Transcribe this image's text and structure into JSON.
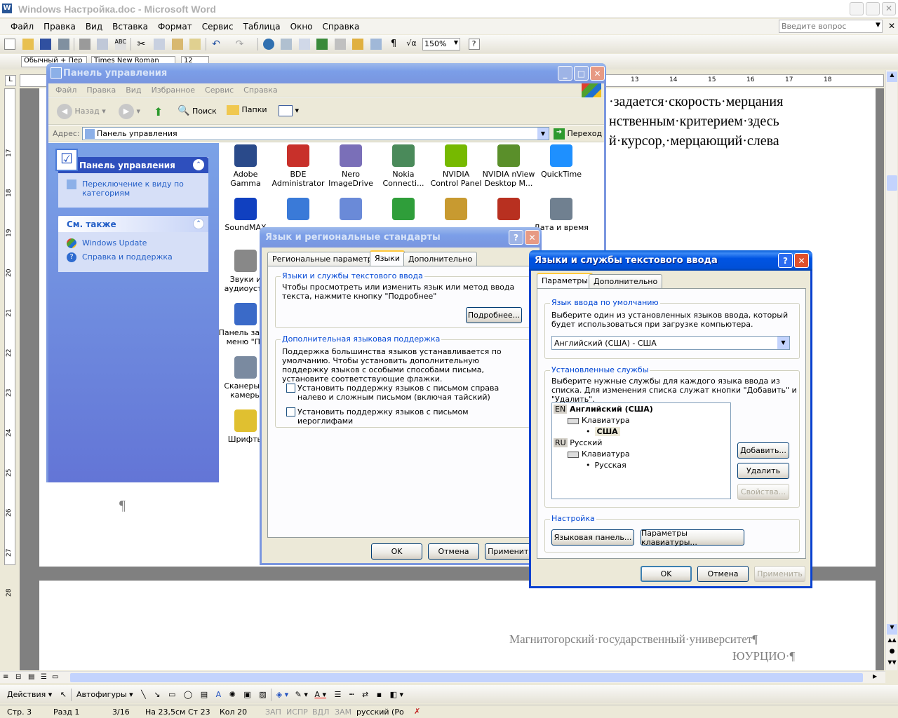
{
  "word": {
    "title": "Windows Настройка.doc - Microsoft Word",
    "menu": [
      "Файл",
      "Правка",
      "Вид",
      "Вставка",
      "Формат",
      "Сервис",
      "Таблица",
      "Окно",
      "Справка"
    ],
    "help_placeholder": "Введите вопрос",
    "zoom": "150%",
    "style_value": "Обычный + Пер",
    "font_value": "Times New Roman",
    "font_size": "12",
    "ruler_numbers": [
      "13",
      "14",
      "15",
      "16",
      "17",
      "18"
    ],
    "vruler_numbers": [
      "17",
      "18",
      "19",
      "20",
      "21",
      "22",
      "23",
      "24",
      "25",
      "26",
      "27",
      "28"
    ],
    "doc_lines": [
      "·задается·скорость·мерцания",
      "нственным·критерием·здесь",
      "й·курсор,·мерцающий·слева"
    ],
    "pilcrow": "¶",
    "footer_line1": "Магнитогорский·государственный·университет¶",
    "footer_line2": "ЮУРЦИО·¶",
    "draw_actions": "Действия",
    "draw_autoshapes": "Автофигуры",
    "status": [
      "Стр. 3",
      "Разд 1",
      "3/16",
      "На 23,5см",
      "Ст 23",
      "Кол 20",
      "ЗАП",
      "ИСПР",
      "ВДЛ",
      "ЗАМ",
      "русский (Ро"
    ]
  },
  "cp": {
    "title": "Панель управления",
    "menu": [
      "Файл",
      "Правка",
      "Вид",
      "Избранное",
      "Сервис",
      "Справка"
    ],
    "back": "Назад",
    "search": "Поиск",
    "folders": "Папки",
    "address_label": "Адрес:",
    "address_value": "Панель управления",
    "go": "Переход",
    "panel1_title": "Панель управления",
    "panel1_link": "Переключение к виду по категориям",
    "panel2_title": "См. также",
    "panel2_links": [
      "Windows Update",
      "Справка и поддержка"
    ],
    "icons": [
      {
        "label": "Adobe Gamma",
        "color": "#2a4a8a"
      },
      {
        "label": "BDE Administrator",
        "color": "#c8302a"
      },
      {
        "label": "Nero ImageDrive",
        "color": "#7a6fb8"
      },
      {
        "label": "Nokia Connecti...",
        "color": "#4a8a5a"
      },
      {
        "label": "NVIDIA Control Panel",
        "color": "#76b900"
      },
      {
        "label": "NVIDIA nView Desktop M...",
        "color": "#5a8f2a"
      },
      {
        "label": "QuickTime",
        "color": "#1e90ff"
      },
      {
        "label": "SoundMAX",
        "color": "#1040c0"
      },
      {
        "label": "",
        "color": "#3a7ad8"
      },
      {
        "label": "",
        "color": "#6a8ad8"
      },
      {
        "label": "",
        "color": "#2f9e3a"
      },
      {
        "label": "",
        "color": "#c89a30"
      },
      {
        "label": "",
        "color": "#b83020"
      },
      {
        "label": "Дата и время",
        "color": "#708090"
      },
      {
        "label": "Звуки и аудиоустр",
        "color": "#888888"
      },
      {
        "label": "Панель зад и меню \"Пу",
        "color": "#3a6ac8"
      },
      {
        "label": "Сканеры и камеры",
        "color": "#7a8aa0"
      },
      {
        "label": "Шрифты",
        "color": "#e0c030"
      }
    ]
  },
  "lang": {
    "title": "Язык и региональные стандарты",
    "tabs": [
      "Региональные параметры",
      "Языки",
      "Дополнительно"
    ],
    "group1_title": "Языки и службы текстового ввода",
    "group1_text": "Чтобы просмотреть или изменить язык или метод ввода текста, нажмите кнопку \"Подробнее\"",
    "details_btn": "Подробнее...",
    "group2_title": "Дополнительная языковая поддержка",
    "group2_text": "Поддержка большинства языков устанавливается по умолчанию. Чтобы установить дополнительную поддержку языков с особыми способами письма, установите соответствующие флажки.",
    "check1": "Установить поддержку языков с письмом справа налево и сложным письмом (включая тайский)",
    "check2": "Установить поддержку языков с письмом иероглифами",
    "ok": "OK",
    "cancel": "Отмена",
    "apply": "Применить"
  },
  "svc": {
    "title": "Языки и службы текстового ввода",
    "tabs": [
      "Параметры",
      "Дополнительно"
    ],
    "default_group": "Язык ввода по умолчанию",
    "default_text": "Выберите один из установленных языков ввода, который будет использоваться при загрузке компьютера.",
    "default_value": "Английский (США) - США",
    "installed_group": "Установленные службы",
    "installed_text": "Выберите нужные службы для каждого языка ввода из списка. Для изменения списка служат кнопки \"Добавить\" и \"Удалить\".",
    "tree": {
      "en_code": "EN",
      "en_name": "Английский (США)",
      "en_kbd": "Клавиатура",
      "en_layout": "США",
      "ru_code": "RU",
      "ru_name": "Русский",
      "ru_kbd": "Клавиатура",
      "ru_layout": "Русская"
    },
    "add": "Добавить...",
    "remove": "Удалить",
    "props": "Свойства...",
    "settings_group": "Настройка",
    "langbar_btn": "Языковая панель...",
    "keys_btn": "Параметры клавиатуры...",
    "ok": "OK",
    "cancel": "Отмена",
    "apply": "Применить"
  }
}
